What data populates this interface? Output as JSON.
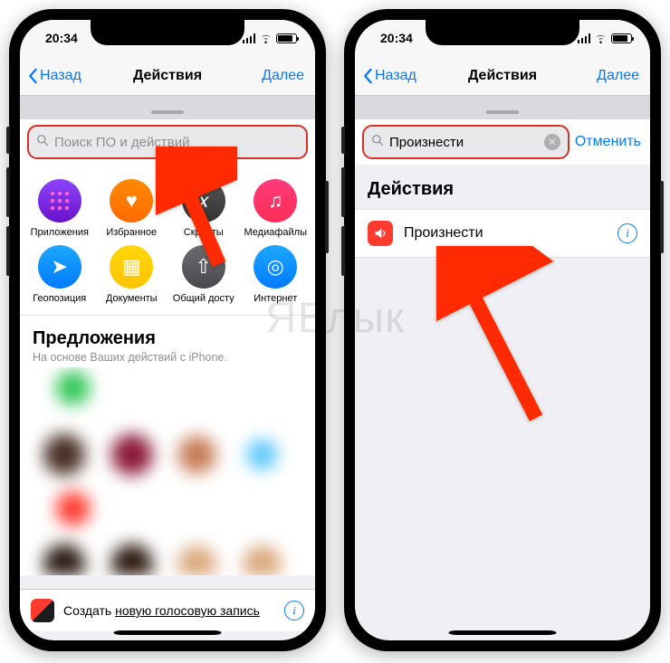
{
  "status": {
    "time": "20:34"
  },
  "nav": {
    "back": "Назад",
    "title": "Действия",
    "next": "Далее"
  },
  "left": {
    "search_placeholder": "Поиск ПО и действий",
    "categories_row1": [
      {
        "label": "Приложения",
        "cls": "ic-apps",
        "glyph": ""
      },
      {
        "label": "Избранное",
        "cls": "ic-heart",
        "glyph": "♥"
      },
      {
        "label": "Скрипты",
        "cls": "ic-script",
        "glyph": "𝑥"
      },
      {
        "label": "Медиафайлы",
        "cls": "ic-media",
        "glyph": "♫"
      }
    ],
    "categories_row2": [
      {
        "label": "Геопозиция",
        "cls": "ic-geo",
        "glyph": "➤"
      },
      {
        "label": "Документы",
        "cls": "ic-docs",
        "glyph": "▦"
      },
      {
        "label": "Общий досту",
        "cls": "ic-share",
        "glyph": "⇧"
      },
      {
        "label": "Интернет",
        "cls": "ic-web",
        "glyph": "◎"
      }
    ],
    "suggestions_title": "Предложения",
    "suggestions_sub": "На основе Ваших действий с iPhone.",
    "bottom": {
      "prefix": "Создать ",
      "underlined": "новую голосовую запись"
    }
  },
  "right": {
    "search_value": "Произнести",
    "cancel": "Отменить",
    "section": "Действия",
    "result": "Произнести"
  },
  "watermark": "ЯБлык"
}
